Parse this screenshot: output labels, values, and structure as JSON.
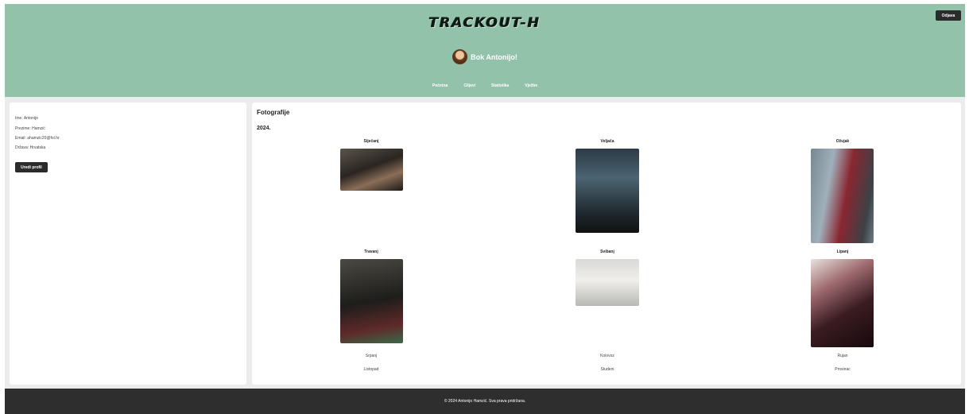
{
  "header": {
    "logo_text": "TRACKOUT-H",
    "logout_label": "Odjava",
    "greeting": "Bok Antonijo!",
    "nav": [
      "Početna",
      "Ciljevi",
      "Statistika",
      "Vježbe"
    ]
  },
  "profile": {
    "ime": "Ime: Antonijo",
    "prezime": "Prezime: Hamzić",
    "email": "Email: ahamzic20@foi.hr",
    "drzava": "Država: Hrvatska",
    "edit_label": "Uredi profil"
  },
  "photos": {
    "title": "Fotografije",
    "year": "2024.",
    "months_with_photos": [
      "Siječanj",
      "Veljača",
      "Ožujak",
      "Travanj",
      "Svibanj",
      "Lipanj"
    ],
    "months_without_photos": [
      "Srpanj",
      "Kolovoz",
      "Rujan",
      "Listopad",
      "Studeni",
      "Prosinac"
    ]
  },
  "footer": {
    "text": "© 2024 Antonijo Hamzić. Sva prava pridržana."
  }
}
